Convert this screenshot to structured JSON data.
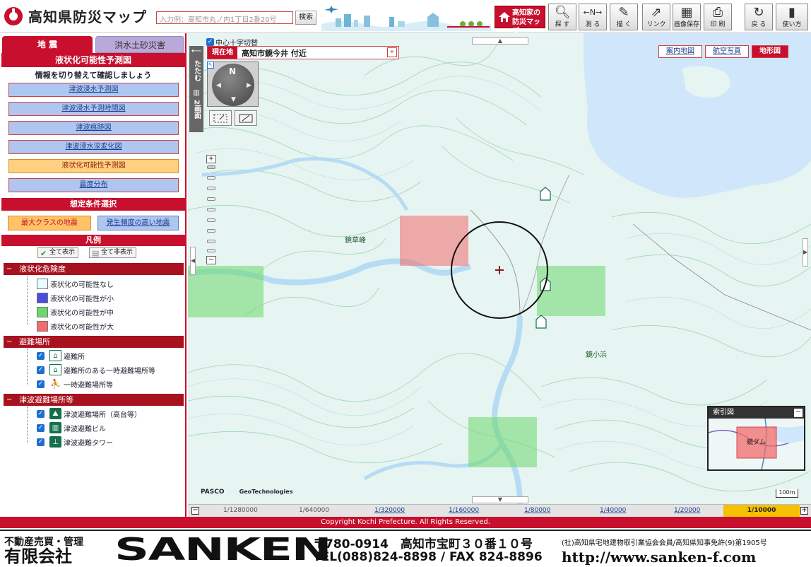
{
  "header": {
    "site_title": "高知県防災マップ",
    "search_placeholder": "入力例：高知市丸ノ内1丁目2番20号",
    "search_button": "検索",
    "home_button_line1": "高知家の",
    "home_button_line2": "防災マップ",
    "tools": [
      {
        "label": "探 す",
        "icon": "magnifier-icon"
      },
      {
        "label": "測 る",
        "icon": "ruler-icon"
      },
      {
        "label": "描 く",
        "icon": "palette-icon"
      },
      {
        "label": "リンク",
        "icon": "link-icon"
      },
      {
        "label": "画像保存",
        "icon": "image-save-icon"
      },
      {
        "label": "印 刷",
        "icon": "printer-icon"
      },
      {
        "label": "戻 る",
        "icon": "undo-icon"
      },
      {
        "label": "使い方",
        "icon": "help-icon"
      }
    ]
  },
  "sidebar": {
    "tabs": [
      "地 震",
      "洪水土砂災害"
    ],
    "section_title": "液状化可能性予測図",
    "note": "情報を切り替えて確認しましょう",
    "map_buttons": [
      {
        "label": "津波浸水予測図",
        "active": false
      },
      {
        "label": "津波浸水予測時間図",
        "active": false
      },
      {
        "label": "津波痕跡図",
        "active": false
      },
      {
        "label": "津波浸水深変化図",
        "active": false
      },
      {
        "label": "液状化可能性予測図",
        "active": true
      },
      {
        "label": "震度分布",
        "active": false
      }
    ],
    "condition_title": "想定条件選択",
    "condition_buttons": [
      "最大クラスの地震",
      "発生頻度の高い地震"
    ],
    "legend_title": "凡例",
    "show_all": "全て表示",
    "hide_all": "全て非表示",
    "groups": [
      {
        "title": "液状化危険度",
        "items": [
          {
            "label": "液状化の可能性なし",
            "color": "#eafcff"
          },
          {
            "label": "液状化の可能性が小",
            "color": "#4a4ee0"
          },
          {
            "label": "液状化の可能性が中",
            "color": "#6cd86c"
          },
          {
            "label": "液状化の可能性が大",
            "color": "#f26c6c"
          }
        ]
      },
      {
        "title": "避難場所",
        "items": [
          {
            "label": "避難所",
            "icon": "shelter-icon"
          },
          {
            "label": "避難所のある一時避難場所等",
            "icon": "shelter-temporary-icon"
          },
          {
            "label": "一時避難場所等",
            "icon": "running-person-icon"
          }
        ]
      },
      {
        "title": "津波避難場所等",
        "items": [
          {
            "label": "津波避難場所（高台等）",
            "icon": "tsunami-highland-icon"
          },
          {
            "label": "津波避難ビル",
            "icon": "tsunami-building-icon"
          },
          {
            "label": "津波避難タワー",
            "icon": "tsunami-tower-icon"
          }
        ]
      }
    ]
  },
  "map": {
    "center_cross_label": "中心十字切替",
    "location_label": "現在地",
    "location_value": "高知市鏡今井 付近",
    "fold_label": "たたむ",
    "split_label": "2画面",
    "compass_north": "N",
    "layer_tabs": [
      {
        "label": "案内地図",
        "active": false
      },
      {
        "label": "航空写真",
        "active": false
      },
      {
        "label": "地形図",
        "active": true
      }
    ],
    "place_labels": [
      "鏡草峰",
      "鏡小浜"
    ],
    "attribution": [
      "PASCO",
      "GeoTechnologies"
    ],
    "scale_text": "100m",
    "index_map_title": "索引図",
    "index_map_label": "鏡ダム"
  },
  "scales": [
    {
      "label": "1/1280000",
      "link": false,
      "active": false
    },
    {
      "label": "1/640000",
      "link": false,
      "active": false
    },
    {
      "label": "1/320000",
      "link": true,
      "active": false
    },
    {
      "label": "1/160000",
      "link": true,
      "active": false
    },
    {
      "label": "1/80000",
      "link": true,
      "active": false
    },
    {
      "label": "1/40000",
      "link": true,
      "active": false
    },
    {
      "label": "1/20000",
      "link": true,
      "active": false
    },
    {
      "label": "1/10000",
      "link": false,
      "active": true
    }
  ],
  "copyright": "Copyright Kochi Prefecture. All Rights Reserved.",
  "banner": {
    "subtitle": "不動産売買・管理",
    "corp_type": "有限会社",
    "brand": "SANKEN",
    "address": "〒780-0914　高知市宝町３０番１０号",
    "tel_fax": "TEL(088)824-8898 / FAX 824-8896",
    "association": "(社)高知県宅地建物取引業協会会員/高知県知事免許(9)第1905号",
    "url": "http://www.sanken-f.com"
  }
}
